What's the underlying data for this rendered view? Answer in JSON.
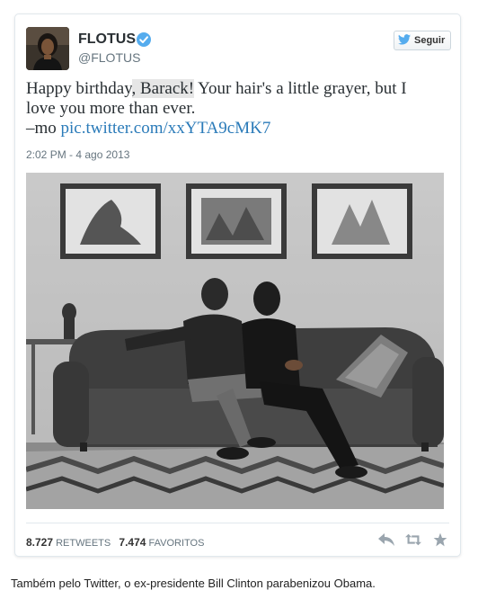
{
  "tweet": {
    "display_name": "FLOTUS",
    "handle": "@FLOTUS",
    "follow_label": "Seguir",
    "text_line1_pre": "Happy birthday",
    "text_line1_hl": ", Barack!",
    "text_line1_post": " Your hair's a little grayer, but I",
    "text_line2": "love you more than ever.",
    "text_line3_pre": "–mo ",
    "text_link": "pic.twitter.com/xxYTA9cMK7",
    "timestamp": "2:02 PM - 4 ago 2013",
    "retweets_count": "8.727",
    "retweets_label": "RETWEETS",
    "favorites_count": "7.474",
    "favorites_label": "FAVORITOS"
  },
  "icons": {
    "verified": "verified-badge-icon",
    "twitter_bird": "twitter-bird-icon",
    "reply": "reply-icon",
    "retweet": "retweet-icon",
    "favorite": "star-icon"
  },
  "colors": {
    "link": "#2b7bb9",
    "verified": "#55acee",
    "muted": "#66757f"
  },
  "caption": "Também pelo Twitter, o ex-presidente Bill Clinton parabenizou Obama."
}
